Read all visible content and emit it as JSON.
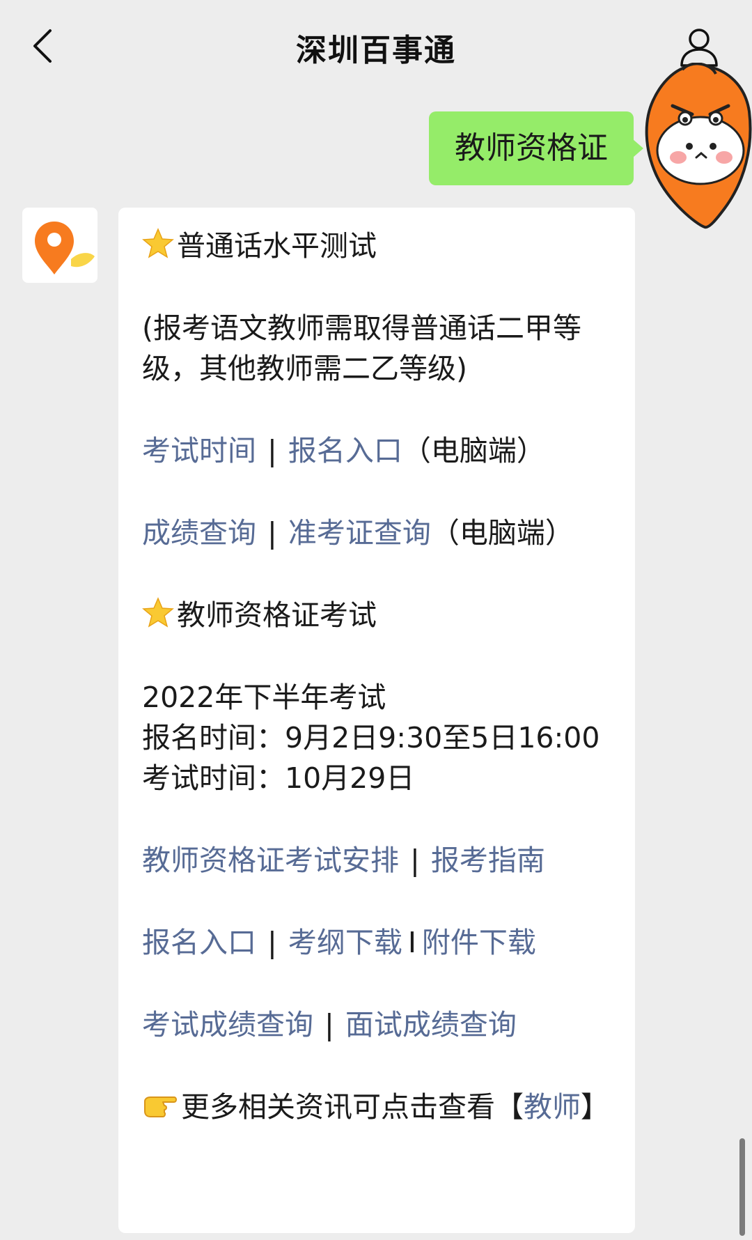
{
  "header": {
    "title": "深圳百事通"
  },
  "user_message": "教师资格证",
  "bot": {
    "section1_title": "普通话水平测试",
    "section1_note": "(报考语文教师需取得普通话二甲等级，其他教师需二乙等级)",
    "row1": {
      "link1": "考试时间",
      "sep": "|",
      "link2": "报名入口",
      "suffix": "（电脑端）"
    },
    "row2": {
      "link1": "成绩查询",
      "sep": "|",
      "link2": "准考证查询",
      "suffix": "（电脑端）"
    },
    "section2_title": "教师资格证考试",
    "exam_info": {
      "line1": "2022年下半年考试",
      "line2": "报名时间：9月2日9:30至5日16:00",
      "line3": "考试时间：10月29日"
    },
    "row3": {
      "link1": "教师资格证考试安排",
      "sep": "|",
      "link2": "报考指南"
    },
    "row4": {
      "link1": "报名入口",
      "sep1": "|",
      "link2": "考纲下载",
      "sep2": "I",
      "link3": "附件下载"
    },
    "row5": {
      "link1": "考试成绩查询",
      "sep": "|",
      "link2": "面试成绩查询"
    },
    "more": {
      "text": "更多相关资讯可点击查看",
      "bracket_open": "【",
      "link": "教师",
      "bracket_close": "】"
    }
  },
  "icons": {
    "back": "chevron-left-icon",
    "profile": "person-icon",
    "star": "star-emoji-icon",
    "hand": "pointing-hand-icon",
    "location": "location-pin-icon"
  },
  "colors": {
    "background": "#ededed",
    "user_bubble": "#95ec69",
    "link": "#576b95",
    "pin_orange": "#f77b1f",
    "pin_yellow": "#f9d548"
  }
}
